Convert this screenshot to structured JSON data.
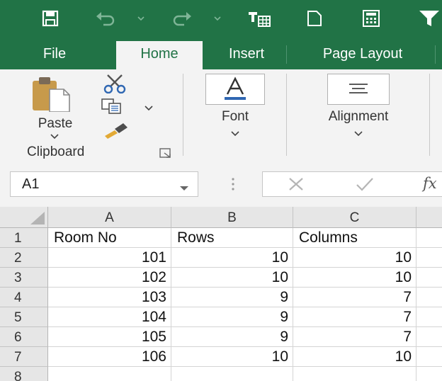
{
  "quick_access": {
    "icons": [
      "save-icon",
      "undo-icon",
      "redo-icon",
      "format-painter-icon",
      "new-document-icon",
      "calculator-icon",
      "filter-icon"
    ]
  },
  "tabs": [
    {
      "label": "File",
      "active": false
    },
    {
      "label": "Home",
      "active": true
    },
    {
      "label": "Insert",
      "active": false
    },
    {
      "label": "Page Layout",
      "active": false
    }
  ],
  "ribbon": {
    "clipboard": {
      "paste_label": "Paste",
      "group_label": "Clipboard"
    },
    "font": {
      "label": "Font"
    },
    "alignment": {
      "label": "Alignment"
    }
  },
  "formula_bar": {
    "name_box": "A1",
    "fx": "fx"
  },
  "sheet": {
    "columns": [
      "A",
      "B",
      "C"
    ],
    "rows": [
      {
        "num": "1",
        "cells": [
          "Room No",
          "Rows",
          "Columns"
        ]
      },
      {
        "num": "2",
        "cells": [
          "101",
          "10",
          "10"
        ]
      },
      {
        "num": "3",
        "cells": [
          "102",
          "10",
          "10"
        ]
      },
      {
        "num": "4",
        "cells": [
          "103",
          "9",
          "7"
        ]
      },
      {
        "num": "5",
        "cells": [
          "104",
          "9",
          "7"
        ]
      },
      {
        "num": "6",
        "cells": [
          "105",
          "9",
          "7"
        ]
      },
      {
        "num": "7",
        "cells": [
          "106",
          "10",
          "10"
        ]
      },
      {
        "num": "8",
        "cells": [
          "",
          "",
          ""
        ]
      }
    ]
  },
  "colors": {
    "brand": "#217346",
    "ribbon": "#f3f3f3",
    "header": "#e6e6e6"
  }
}
